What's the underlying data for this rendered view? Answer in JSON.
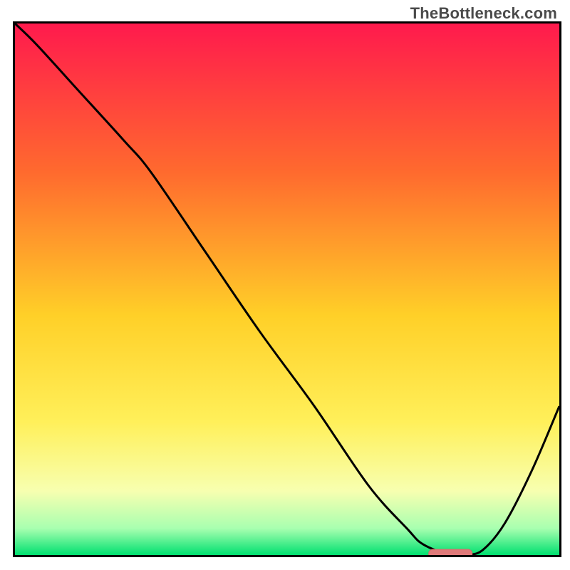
{
  "watermark": "TheBottleneck.com",
  "colors": {
    "frame": "#000000",
    "curve": "#000000",
    "marker_fill": "#e07a7a",
    "marker_stroke": "#d86a6a",
    "grad_top": "#ff1a4d",
    "grad_mid1": "#ff6a2e",
    "grad_mid2": "#ffd028",
    "grad_mid3": "#fff05a",
    "grad_low1": "#f7ffb0",
    "grad_low2": "#a8ffb0",
    "grad_bottom": "#00e070"
  },
  "chart_data": {
    "type": "line",
    "title": "",
    "xlabel": "",
    "ylabel": "",
    "xlim": [
      0,
      100
    ],
    "ylim": [
      0,
      100
    ],
    "x": [
      0,
      4,
      12,
      20,
      25,
      35,
      45,
      55,
      65,
      72,
      75,
      80,
      83,
      86,
      90,
      95,
      100
    ],
    "y": [
      100,
      96,
      87,
      78,
      72,
      57,
      42,
      28,
      13,
      5,
      2,
      0,
      0,
      1,
      6,
      16,
      28
    ],
    "marker": {
      "x0": 76,
      "x1": 84,
      "y": 0
    },
    "notes": "V-shaped bottleneck curve. Minimum (optimal) around x≈80. Values are unlabeled percentages read off a 0–100 normalized axis; the original image has no tick labels."
  }
}
